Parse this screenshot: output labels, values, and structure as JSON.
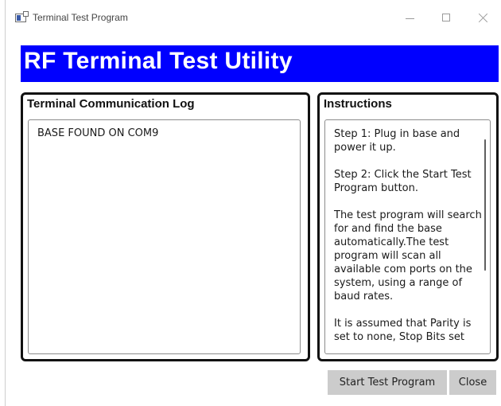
{
  "window": {
    "title": "Terminal Test Program",
    "icon": "app-window-icon"
  },
  "controls": {
    "minimize_icon": "minimize-icon",
    "maximize_icon": "maximize-icon",
    "close_icon": "close-icon"
  },
  "banner": {
    "text": "RF Terminal Test Utility",
    "background_color": "#0000ff",
    "text_color": "#ffffff"
  },
  "log_panel": {
    "heading": "Terminal Communication Log",
    "lines": [
      "BASE FOUND ON COM9"
    ]
  },
  "instructions_panel": {
    "heading": "Instructions",
    "paragraphs": [
      "Step 1: Plug in base and power it up.",
      "Step 2: Click the Start Test Program button.",
      "The test program will search for and find the base automatically.The test program will scan all available com ports on the system, using a range of baud rates.",
      "It is assumed that Parity is set to none, Stop Bits set"
    ]
  },
  "buttons": {
    "start_label": "Start Test Program",
    "close_label": "Close"
  }
}
